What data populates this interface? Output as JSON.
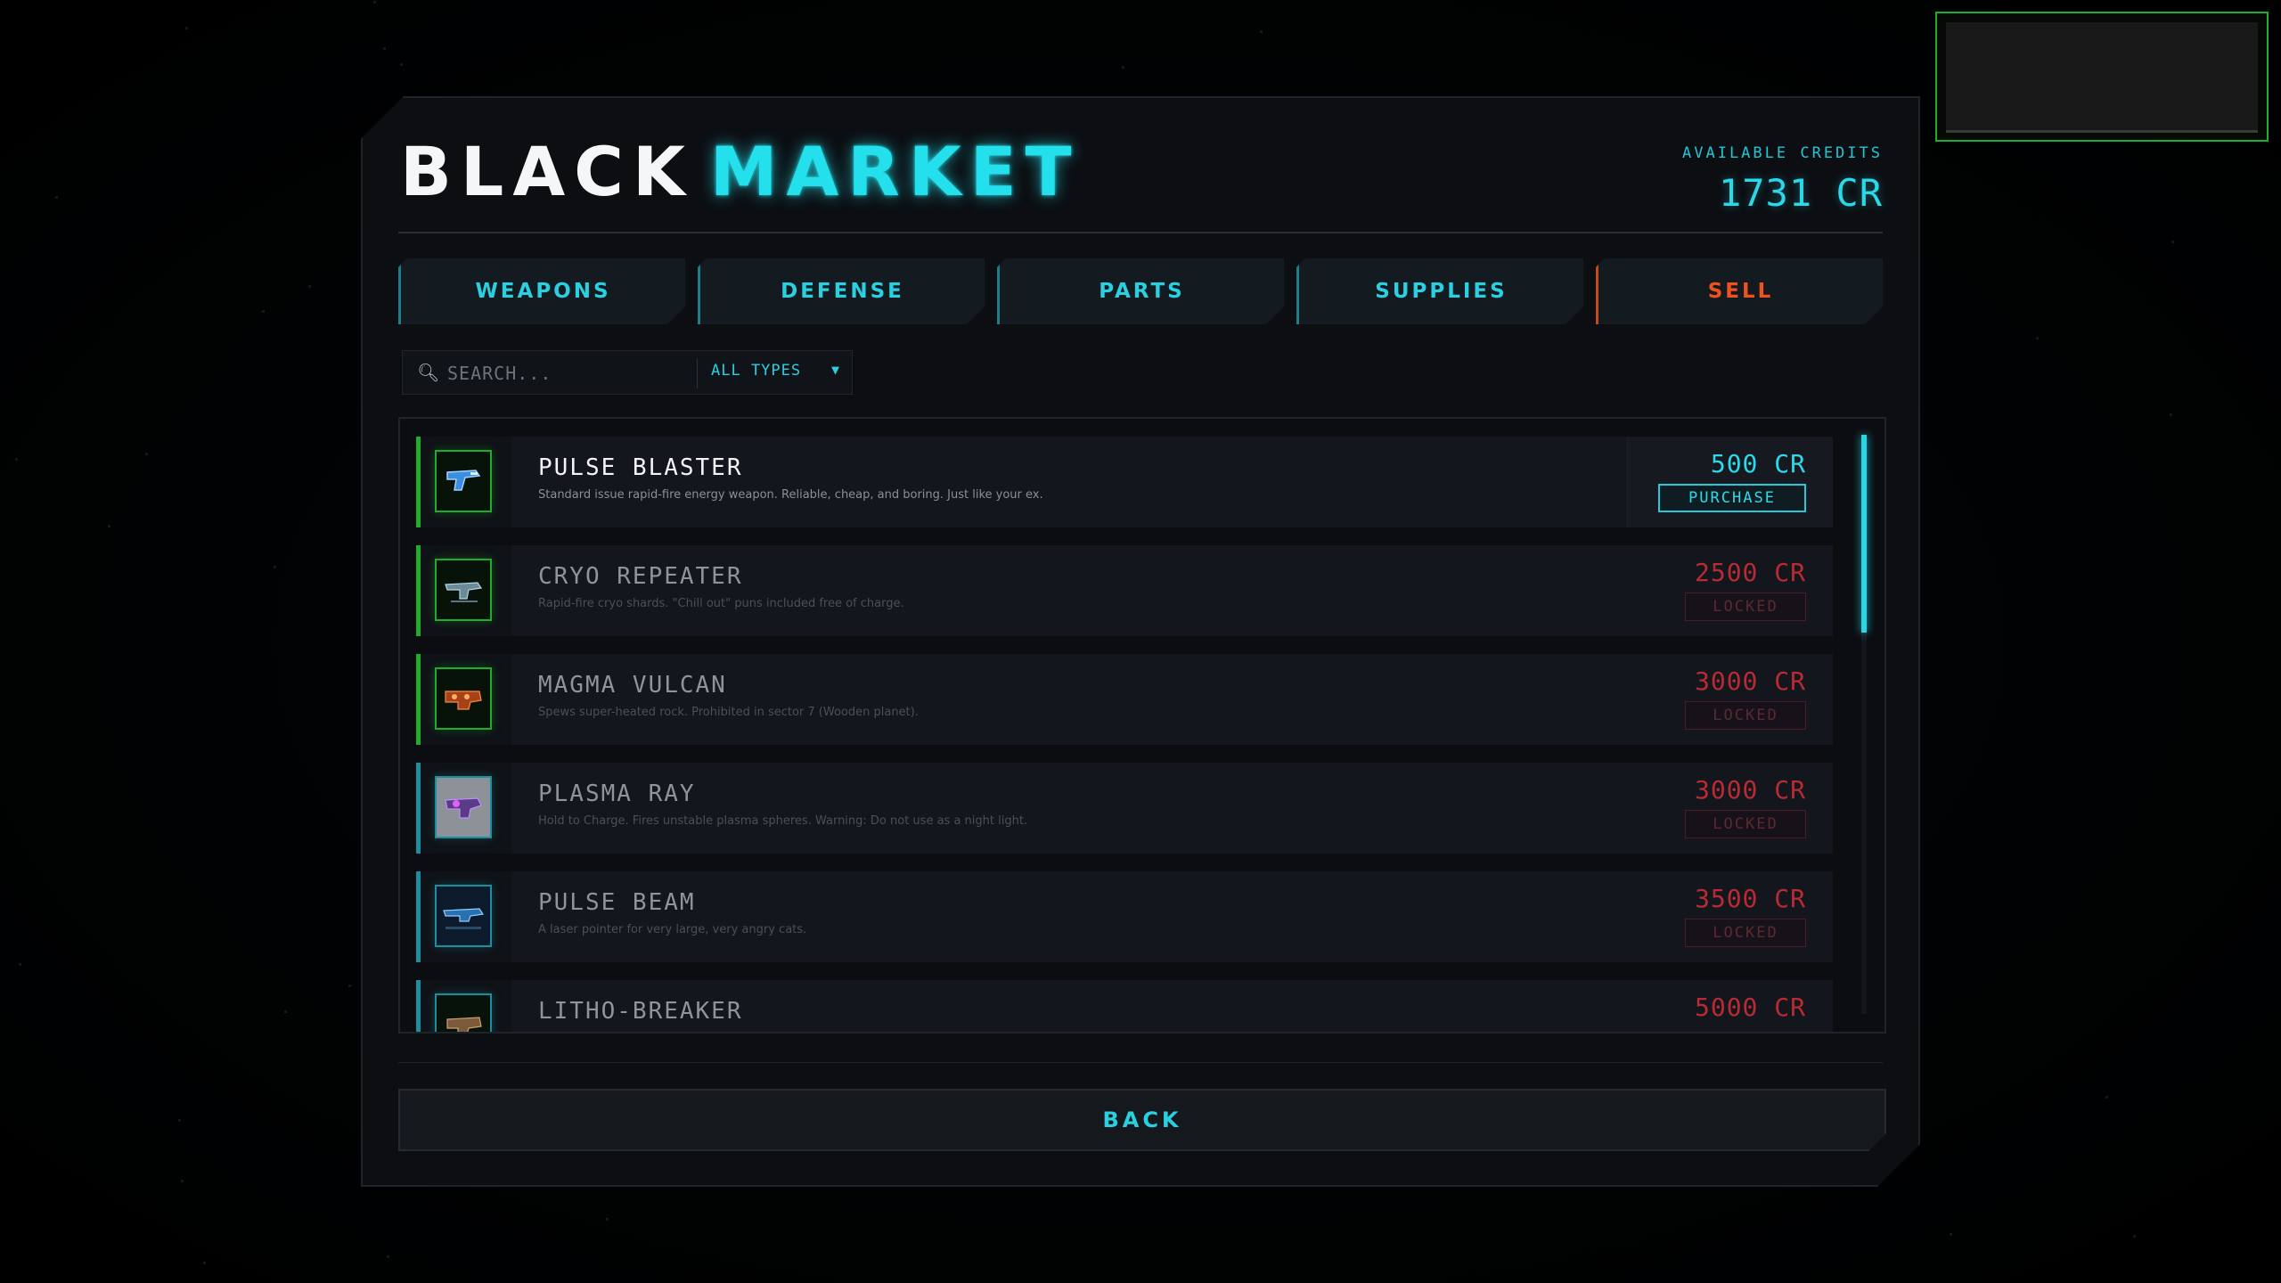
{
  "title": {
    "word1": "BLACK",
    "word2": "MARKET"
  },
  "credits": {
    "label": "AVAILABLE CREDITS",
    "value": "1731 CR"
  },
  "tabs": [
    {
      "label": "WEAPONS"
    },
    {
      "label": "DEFENSE"
    },
    {
      "label": "PARTS"
    },
    {
      "label": "SUPPLIES"
    },
    {
      "label": "SELL"
    }
  ],
  "search": {
    "placeholder": "SEARCH..."
  },
  "filter": {
    "selected": "ALL TYPES"
  },
  "items": [
    {
      "name": "PULSE BLASTER",
      "desc": "Standard issue rapid-fire energy weapon. Reliable, cheap, and boring. Just like your ex.",
      "price": "500 CR",
      "action": "PURCHASE"
    },
    {
      "name": "CRYO REPEATER",
      "desc": "Rapid-fire cryo shards. \"Chill out\" puns included free of charge.",
      "price": "2500 CR",
      "action": "LOCKED"
    },
    {
      "name": "MAGMA VULCAN",
      "desc": "Spews super-heated rock. Prohibited in sector 7 (Wooden planet).",
      "price": "3000 CR",
      "action": "LOCKED"
    },
    {
      "name": "PLASMA RAY",
      "desc": "Hold to Charge. Fires unstable plasma spheres. Warning: Do not use as a night light.",
      "price": "3000 CR",
      "action": "LOCKED"
    },
    {
      "name": "PULSE BEAM",
      "desc": "A laser pointer for very large, very angry cats.",
      "price": "3500 CR",
      "action": "LOCKED"
    },
    {
      "name": "LITHO-BREAKER",
      "desc": "",
      "price": "5000 CR",
      "action": ""
    }
  ],
  "back": {
    "label": "BACK"
  },
  "colors": {
    "accent": "#24e0ec",
    "sell": "#f0521e",
    "locked": "#b82a34",
    "rarity_green": "#1fae2c",
    "rarity_teal": "#1b8ea0"
  }
}
